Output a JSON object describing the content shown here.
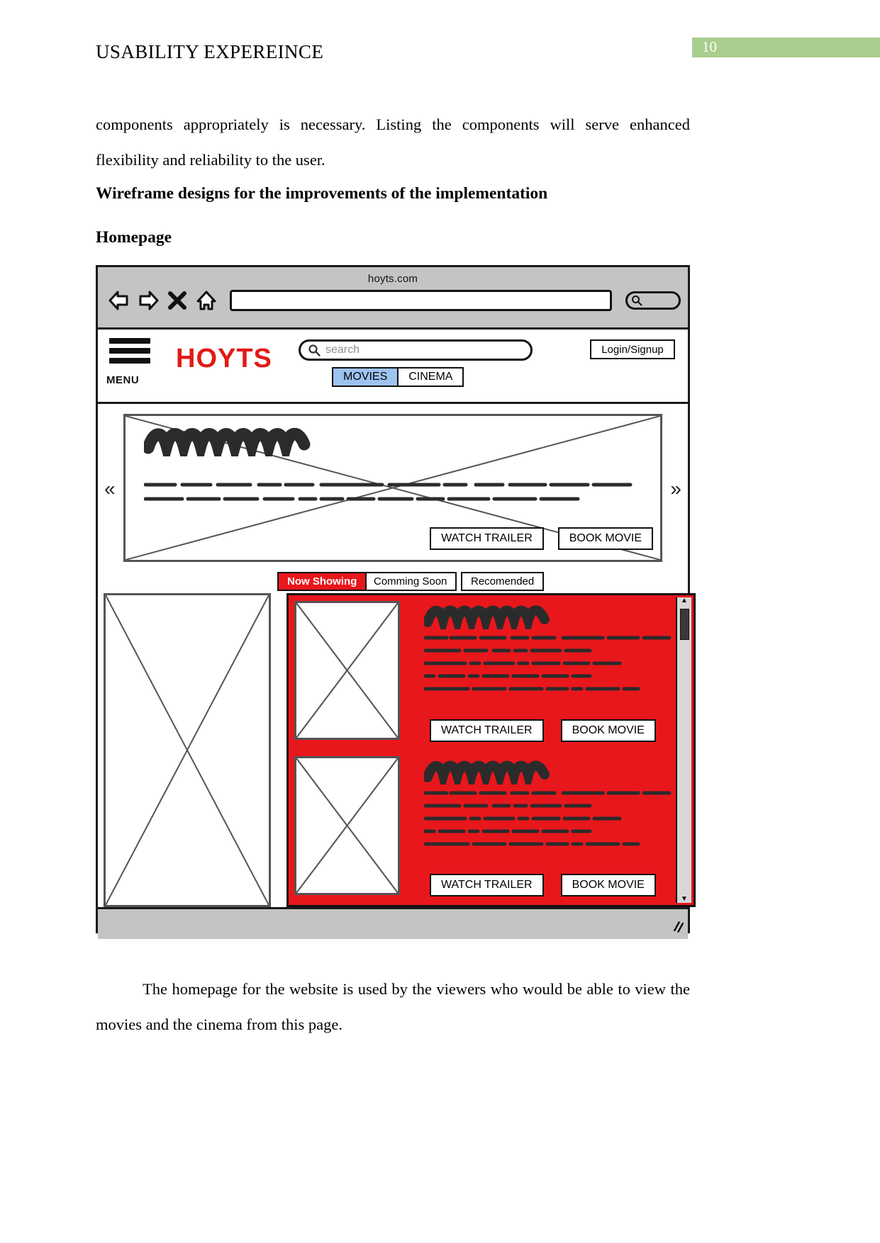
{
  "document": {
    "header_title": "USABILITY EXPEREINCE",
    "page_number": "10",
    "page_number_bg": "#a9ce8e",
    "paragraph_1": "components appropriately is necessary. Listing the components will serve enhanced flexibility and reliability to the user.",
    "heading_wireframe": "Wireframe designs for the improvements of the implementation",
    "heading_homepage": "Homepage",
    "paragraph_2": "The homepage for the website is used by the viewers who would be able to view the movies and the cinema from this page."
  },
  "mockup": {
    "browser": {
      "title": "hoyts.com",
      "url_value": "",
      "back_icon": "back-arrow-icon",
      "forward_icon": "forward-arrow-icon",
      "stop_label": "X",
      "home_icon": "home-icon",
      "search_icon": "search-icon"
    },
    "site_header": {
      "menu_label": "MENU",
      "logo_text": "HOYTS",
      "logo_color": "#e01b16",
      "search_placeholder": "search",
      "search_value": "",
      "login_label": "Login/Signup",
      "nav_tabs": [
        {
          "label": "MOVIES",
          "active": true
        },
        {
          "label": "CINEMA",
          "active": false
        }
      ],
      "active_tab_color": "#9dc3f0"
    },
    "carousel": {
      "prev_label": "«",
      "next_label": "»",
      "watch_trailer_label": "WATCH TRAILER",
      "book_movie_label": "BOOK MOVIE"
    },
    "content_tabs": [
      {
        "label": "Now Showing",
        "active": true
      },
      {
        "label": "Comming Soon",
        "active": false
      },
      {
        "label": "Recomended",
        "active": false
      }
    ],
    "content_tab_active_color": "#e8171c",
    "panel": {
      "background_color": "#e8171c",
      "movies": [
        {
          "watch_trailer_label": "WATCH TRAILER",
          "book_movie_label": "BOOK MOVIE"
        },
        {
          "watch_trailer_label": "WATCH TRAILER",
          "book_movie_label": "BOOK MOVIE"
        }
      ],
      "scroll_up_label": "▲",
      "scroll_down_label": "▼"
    },
    "status_bar": {
      "resize_grip": "//"
    }
  }
}
